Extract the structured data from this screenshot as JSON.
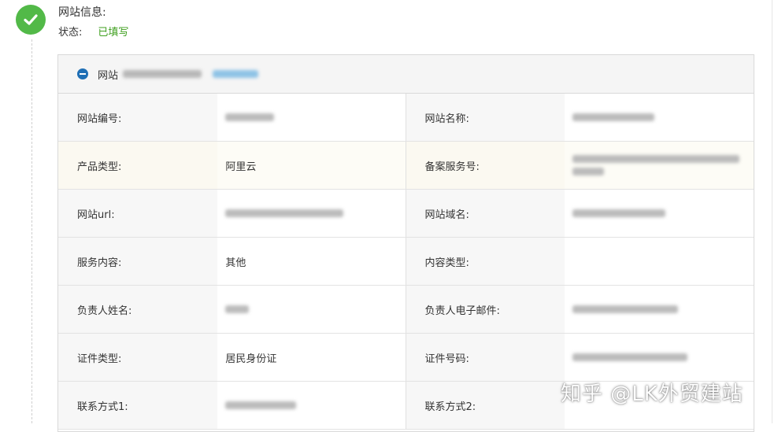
{
  "section": {
    "title": "网站信息:",
    "status_label": "状态:",
    "status_value": "已填写",
    "status_color": "#3f9f1f",
    "check_color": "#52b948",
    "accent_color": "#1f6fb5"
  },
  "panel": {
    "header_label": "网站"
  },
  "rows": [
    {
      "left_label": "网站编号:",
      "left_value": "",
      "right_label": "网站名称:",
      "right_value": ""
    },
    {
      "left_label": "产品类型:",
      "left_value": "阿里云",
      "right_label": "备案服务号:",
      "right_value": ""
    },
    {
      "left_label": "网站url:",
      "left_value": "",
      "right_label": "网站域名:",
      "right_value": ""
    },
    {
      "left_label": "服务内容:",
      "left_value": "其他",
      "right_label": "内容类型:",
      "right_value": ""
    },
    {
      "left_label": "负责人姓名:",
      "left_value": "",
      "right_label": "负责人电子邮件:",
      "right_value": ""
    },
    {
      "left_label": "证件类型:",
      "left_value": "居民身份证",
      "right_label": "证件号码:",
      "right_value": ""
    },
    {
      "left_label": "联系方式1:",
      "left_value": "",
      "right_label": "联系方式2:",
      "right_value": ""
    }
  ],
  "watermark": "知乎 @LK外贸建站",
  "icons": {
    "status": "check-circle-icon",
    "collapse": "minus-circle-icon"
  }
}
